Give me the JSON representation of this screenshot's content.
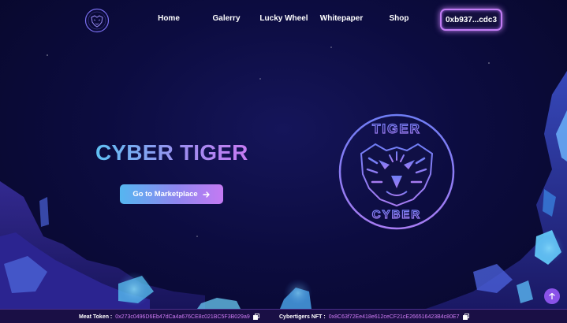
{
  "nav": {
    "logo_icon": "tiger-cyber-logo-icon",
    "links": [
      {
        "label": "Home"
      },
      {
        "label": "Galerry"
      },
      {
        "label": "Lucky Wheel"
      },
      {
        "label": "Whitepaper"
      },
      {
        "label": "Shop"
      }
    ],
    "wallet_label": "0xb937...cdc3"
  },
  "hero": {
    "title": "CYBER TIGER",
    "cta_label": "Go to Marketplace",
    "cta_icon": "arrow-right-icon",
    "emblem": {
      "top_text": "TIGER",
      "bottom_text": "CYBER",
      "icon": "tiger-head-emblem-icon"
    }
  },
  "footer": {
    "meat_token_label": "Meat Token :",
    "meat_token_address": "0x273c0496D6Eb47dCa4a676CE8c021BC5F3B029a9",
    "cybertigers_label": "Cybertigers NFT :",
    "cybertigers_address": "0x8C63f72Ee418e612ceCF21cE266516423B4c80E7",
    "copy_icon": "copy-icon",
    "scroll_icon": "arrow-up-icon"
  },
  "colors": {
    "background": "#0b0b3a",
    "accent_purple": "#c77af2",
    "accent_blue": "#5fc0f2",
    "footer_bg": "#1a0f45"
  }
}
